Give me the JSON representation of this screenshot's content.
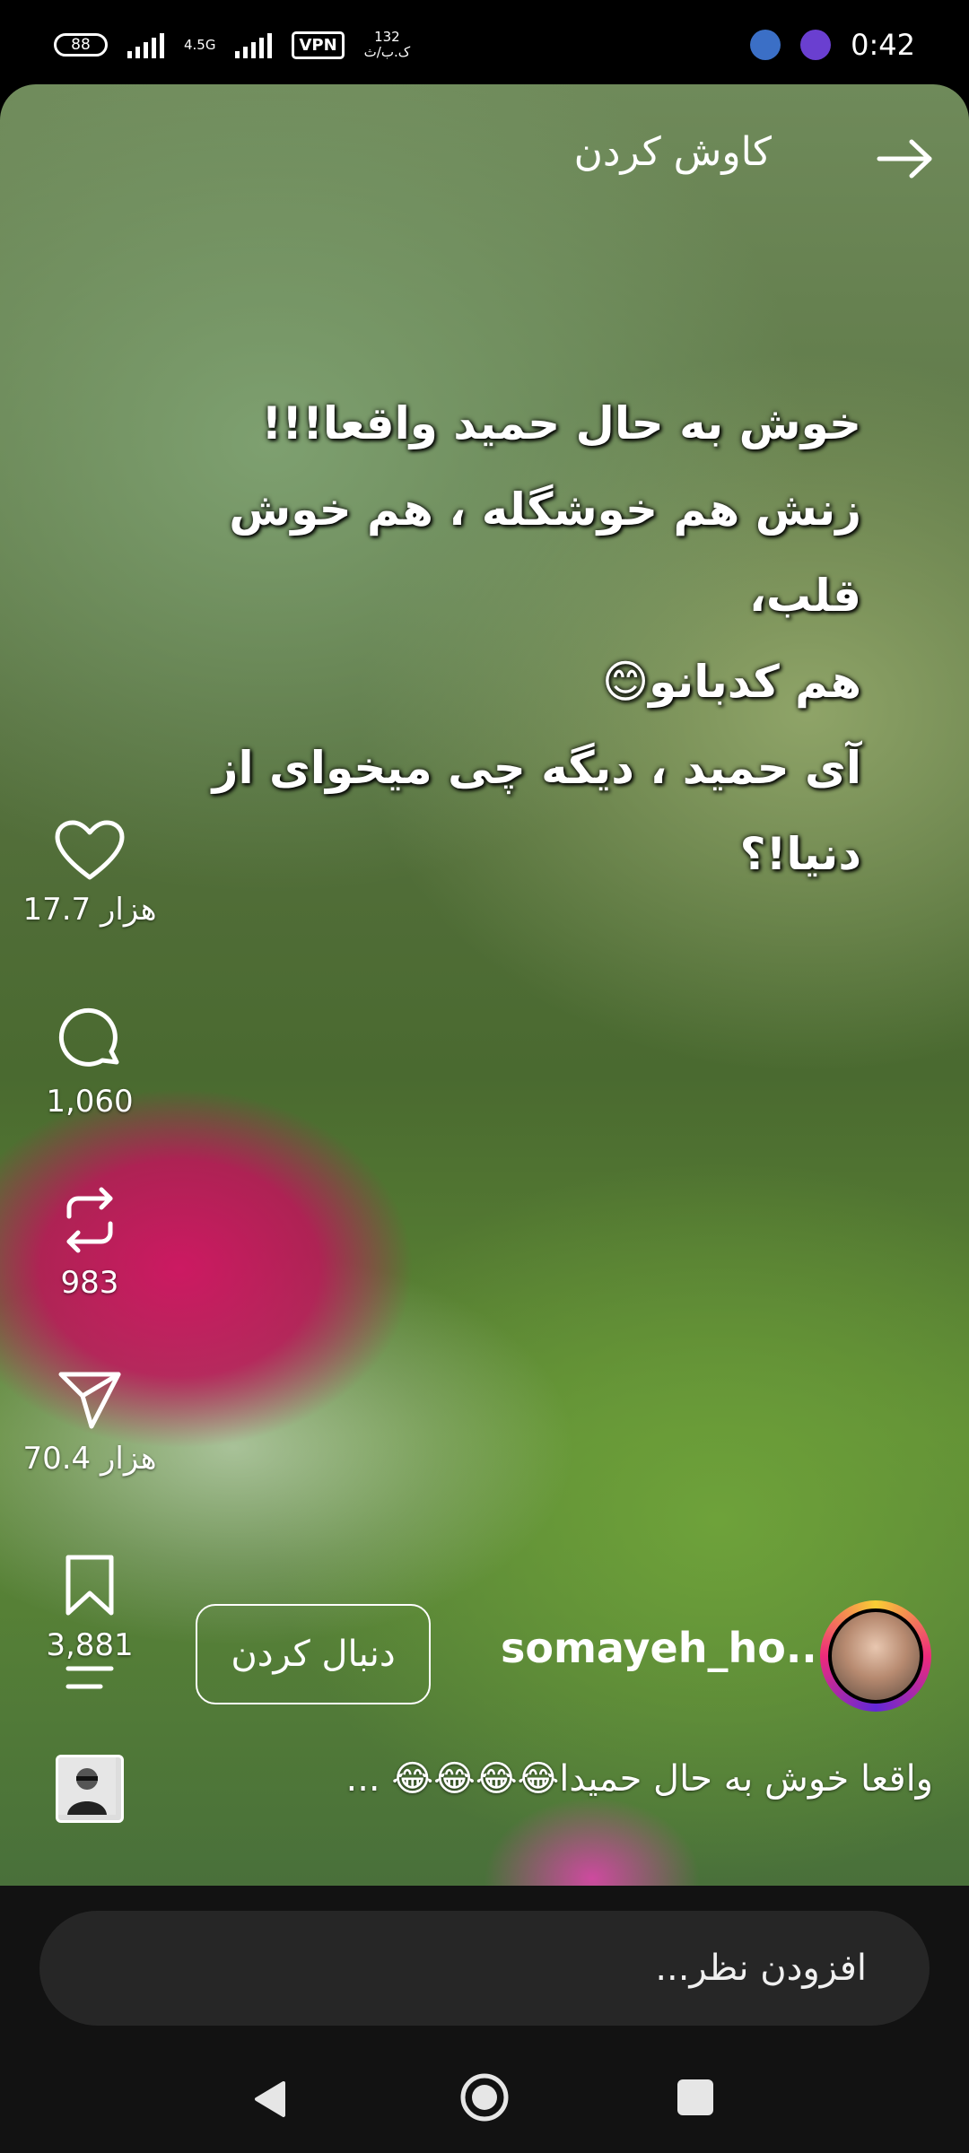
{
  "status_bar": {
    "battery": "88",
    "network_label": "4.5G",
    "vpn": "VPN",
    "speed_value": "132",
    "speed_unit": "ک.ب/ث",
    "time": "0:42"
  },
  "header": {
    "title": "کاوش کردن"
  },
  "overlay_text": [
    "خوش به حال حمید واقعا!!!",
    "زنش هم خوشگله ، هم خوش قلب،",
    "هم کدبانو😊",
    "آی حمید ، دیگه چی میخوای از دنیا!؟"
  ],
  "actions": {
    "likes": "17.7 هزار",
    "comments": "1,060",
    "reposts": "983",
    "shares": "70.4 هزار",
    "saves": "3,881"
  },
  "post": {
    "username": "somayeh_ho...",
    "follow_label": "دنبال کردن",
    "caption": "واقعا خوش به حال حمیدا😂😂😂😂 ..."
  },
  "comment": {
    "placeholder": "افزودن نظر..."
  },
  "colors": {
    "background": "#000000",
    "comment_bar": "#121212",
    "comment_field": "#262626"
  }
}
